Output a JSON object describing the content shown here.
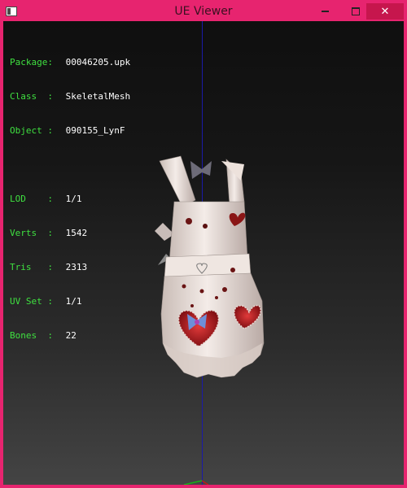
{
  "window": {
    "title": "UE Viewer",
    "controls": {
      "close": "✕"
    }
  },
  "colors": {
    "frame": "#e7246f",
    "label": "#3fe040",
    "value": "#ffffff",
    "axis_y": "#1a1aa8",
    "axis_x": "#c01818",
    "axis_z": "#18b018"
  },
  "info": {
    "package": {
      "label": "Package:",
      "value": "00046205.upk"
    },
    "class": {
      "label": "Class  :",
      "value": "SkeletalMesh"
    },
    "object": {
      "label": "Object :",
      "value": "090155_LynF"
    },
    "lod": {
      "label": "LOD    :",
      "value": "1/1"
    },
    "verts": {
      "label": "Verts  :",
      "value": "1542"
    },
    "tris": {
      "label": "Tris   :",
      "value": "2313"
    },
    "uvset": {
      "label": "UV Set :",
      "value": "1/1"
    },
    "bones": {
      "label": "Bones  :",
      "value": "22"
    }
  },
  "model": {
    "subject": "apron-mesh"
  }
}
